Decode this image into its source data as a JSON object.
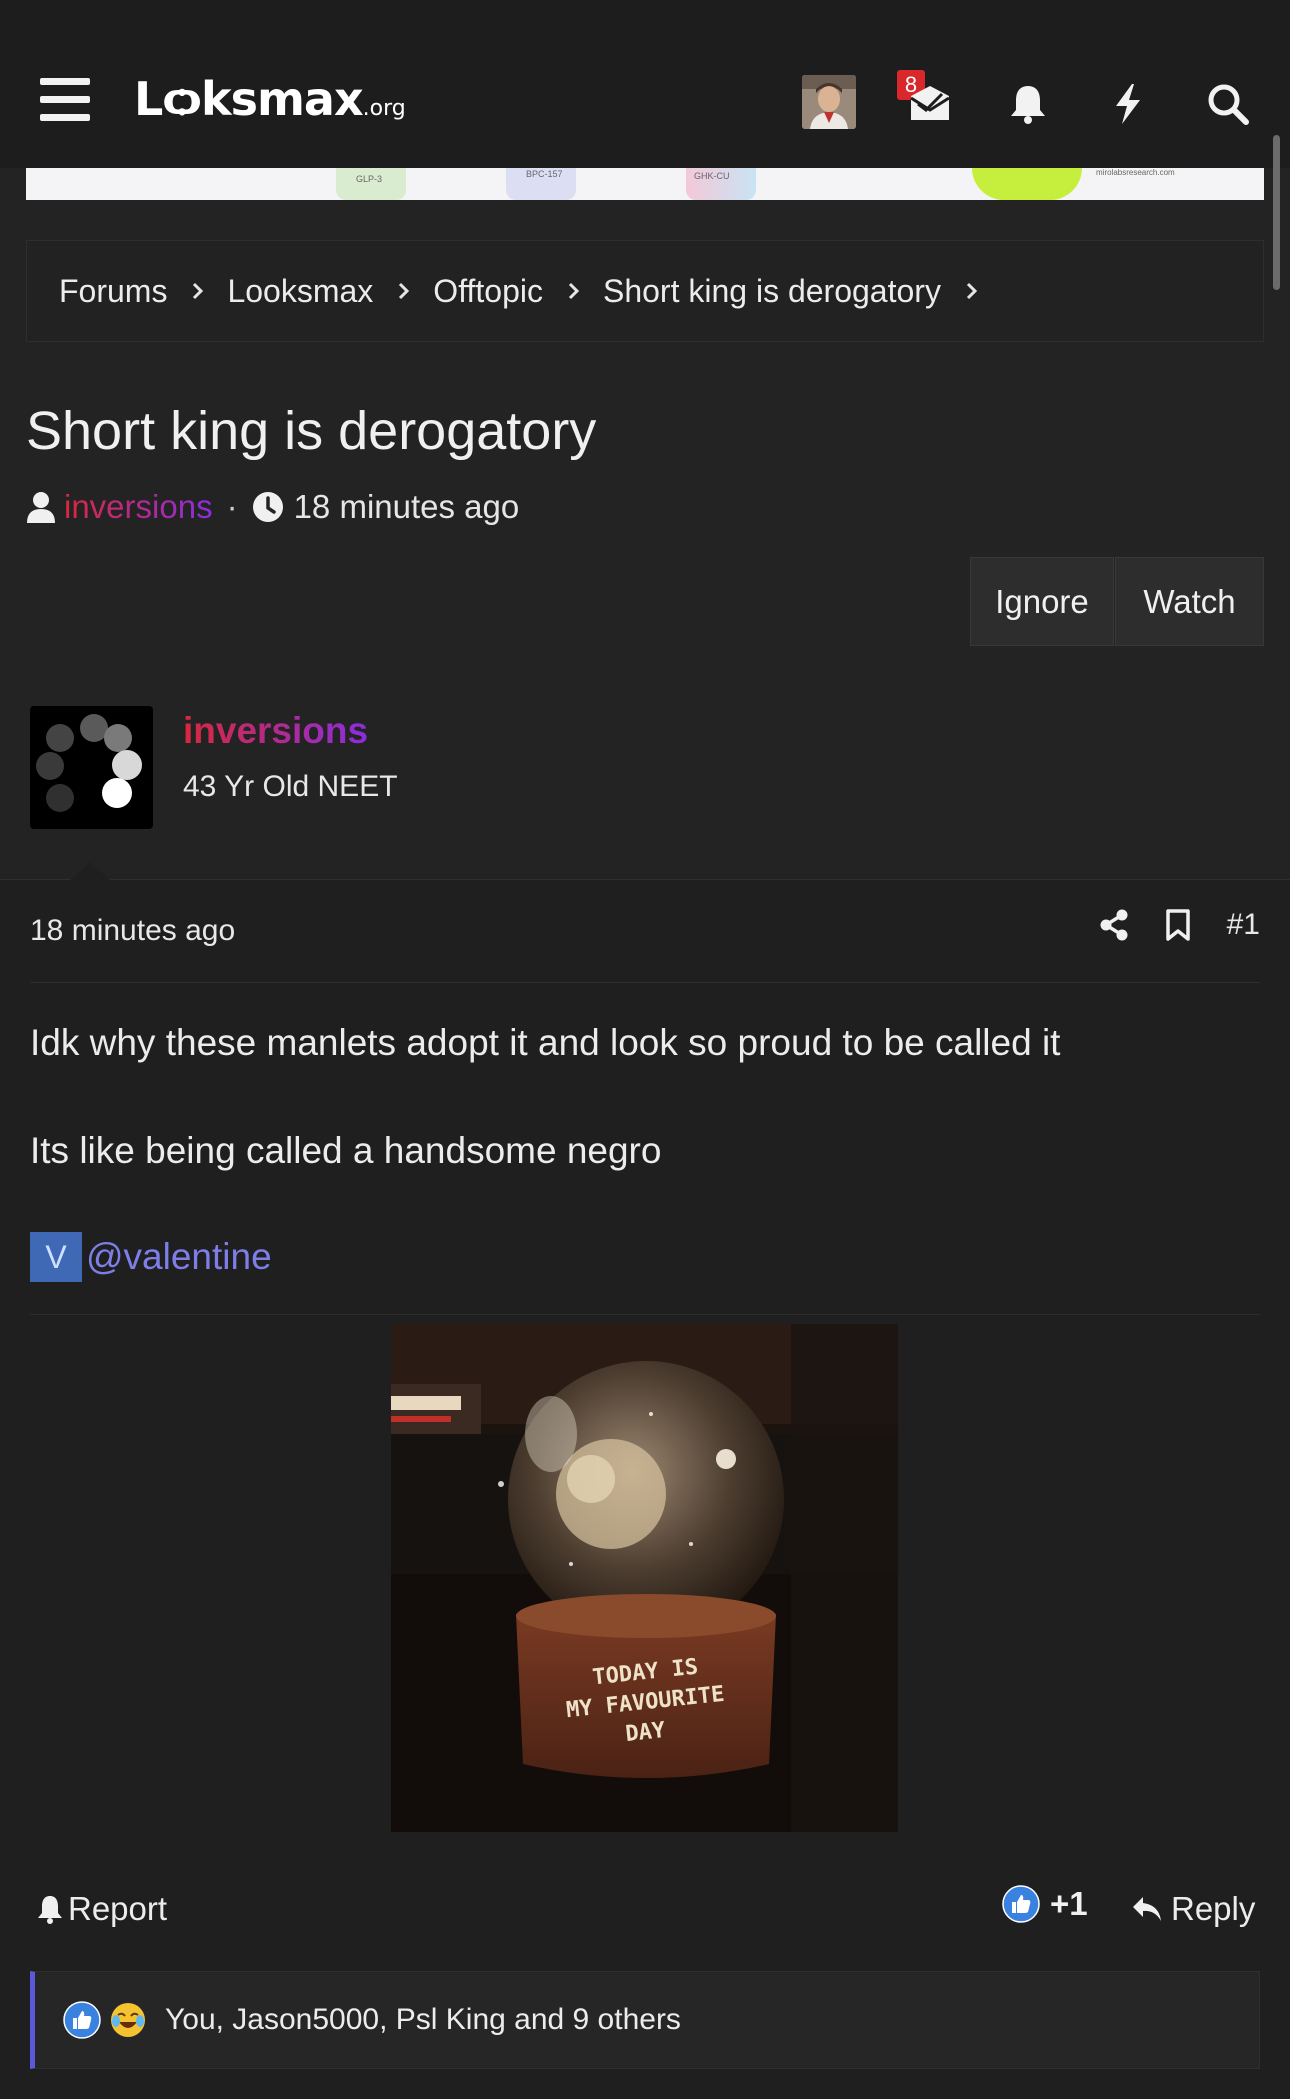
{
  "site": {
    "logo_main": "Lѻksmax",
    "logo_tld": ".org",
    "notification_badge": "8"
  },
  "icons": {
    "menu": "hamburger-icon",
    "inbox": "envelope-icon",
    "alerts": "bell-icon",
    "whats_new": "lightning-icon",
    "search": "search-icon"
  },
  "banner": {
    "labels": [
      "GLP-3",
      "BPC-157",
      "GHK-CU",
      "mirolabsresearch.com"
    ]
  },
  "breadcrumb": [
    "Forums",
    "Looksmax",
    "Offtopic",
    "Short king is derogatory"
  ],
  "thread": {
    "title": "Short king is derogatory",
    "author": "inversions",
    "time": "18 minutes ago",
    "ignore_label": "Ignore",
    "watch_label": "Watch"
  },
  "post": {
    "username": "inversions",
    "user_title": "43 Yr Old NEET",
    "time": "18 minutes ago",
    "number": "#1",
    "line1": "Idk why these manlets adopt it and look so proud to be called it",
    "line2": "Its like being called a handsome negro",
    "mention_initial": "V",
    "mention": "@valentine",
    "image_caption_lines": [
      "TODAY IS",
      "MY FAVOURITE",
      "DAY"
    ],
    "report_label": "Report",
    "like_count": "+1",
    "reply_label": "Reply",
    "reactions_text": "You, Jason5000, Psl King and 9 others"
  },
  "colors": {
    "background": "#232323",
    "navbar": "#1d1d1d",
    "badge": "#d8282c",
    "username_gradient_start": "#d8283c",
    "username_gradient_end": "#8b2de0",
    "mention": "#7e7ee8",
    "reaction_border": "#5a5ad8"
  }
}
